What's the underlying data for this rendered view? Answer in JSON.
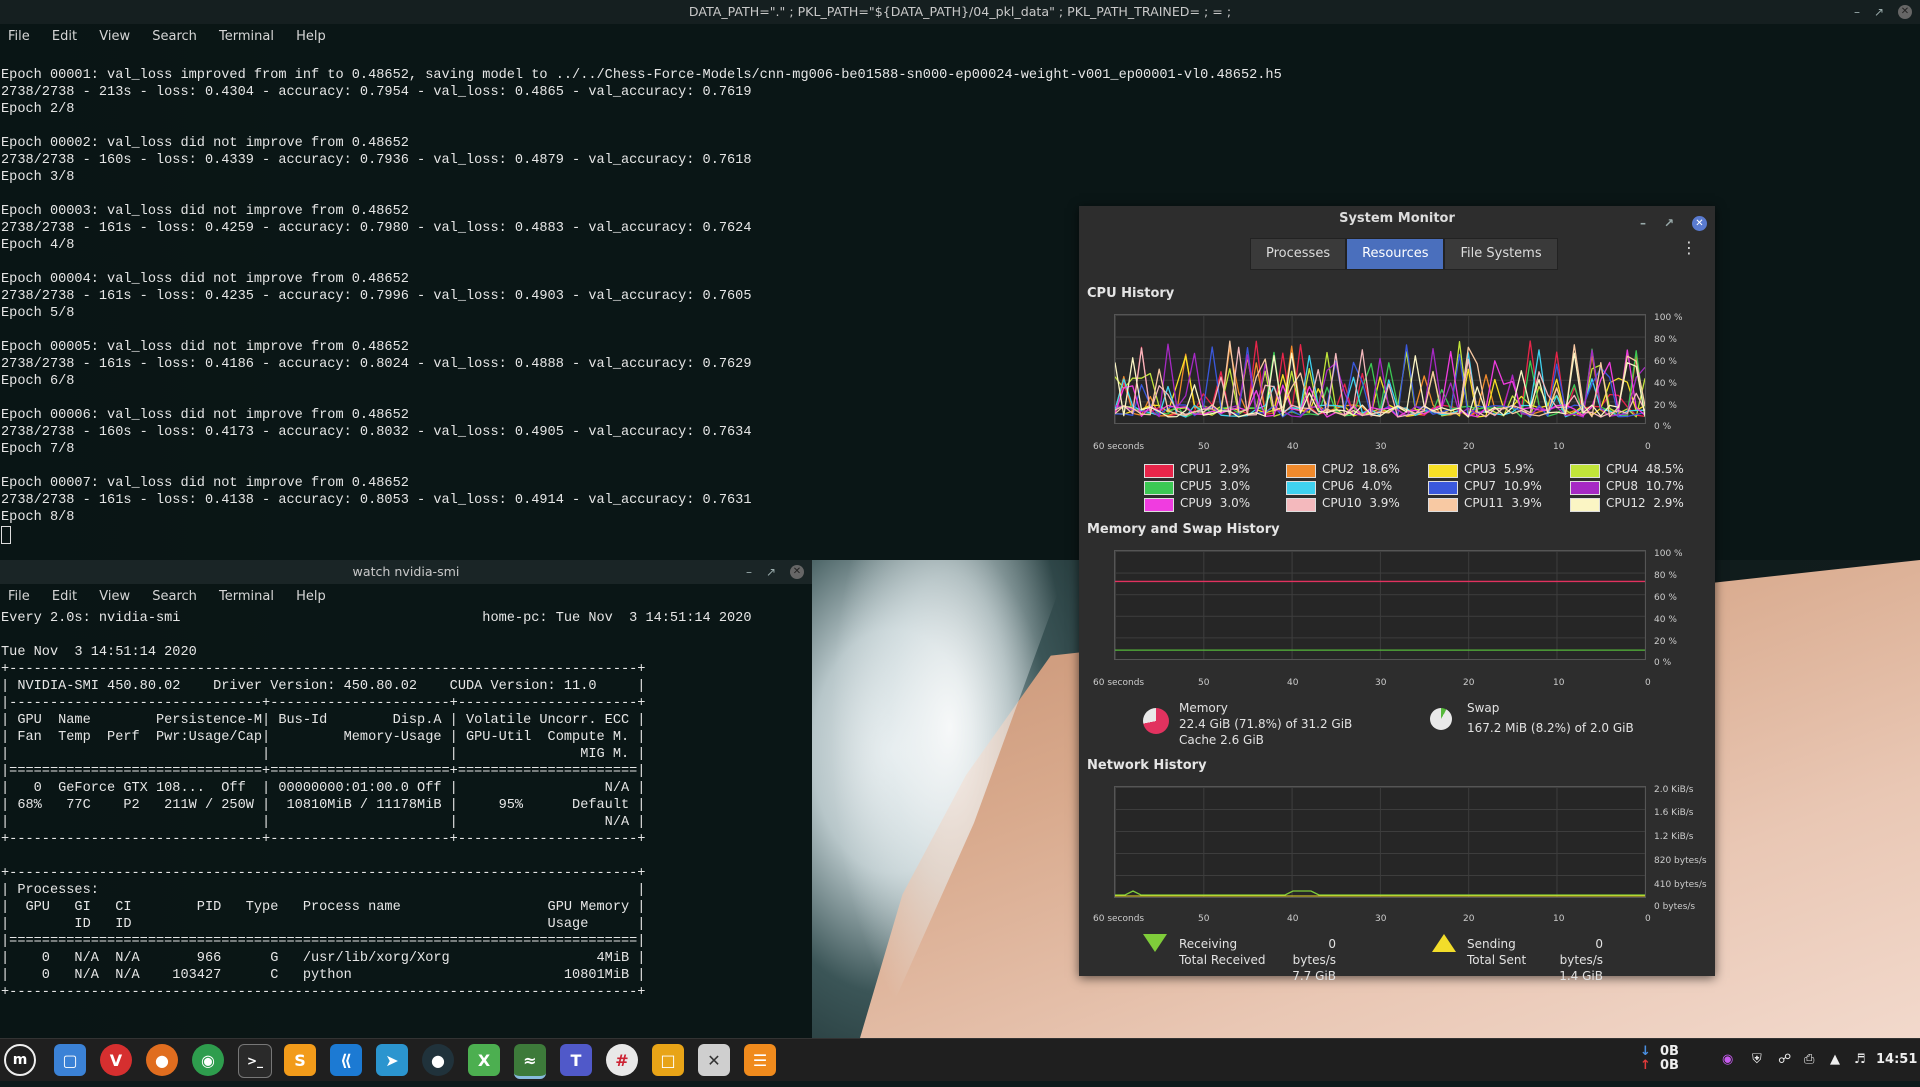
{
  "terminal_top": {
    "title": "DATA_PATH=\".\" ; PKL_PATH=\"${DATA_PATH}/04_pkl_data\" ; PKL_PATH_TRAINED= ; = ;",
    "menu": [
      "File",
      "Edit",
      "View",
      "Search",
      "Terminal",
      "Help"
    ],
    "output": "\nEpoch 00001: val_loss improved from inf to 0.48652, saving model to ../../Chess-Force-Models/cnn-mg006-be01588-sn000-ep00024-weight-v001_ep00001-vl0.48652.h5\n2738/2738 - 213s - loss: 0.4304 - accuracy: 0.7954 - val_loss: 0.4865 - val_accuracy: 0.7619\nEpoch 2/8\n\nEpoch 00002: val_loss did not improve from 0.48652\n2738/2738 - 160s - loss: 0.4339 - accuracy: 0.7936 - val_loss: 0.4879 - val_accuracy: 0.7618\nEpoch 3/8\n\nEpoch 00003: val_loss did not improve from 0.48652\n2738/2738 - 161s - loss: 0.4259 - accuracy: 0.7980 - val_loss: 0.4883 - val_accuracy: 0.7624\nEpoch 4/8\n\nEpoch 00004: val_loss did not improve from 0.48652\n2738/2738 - 161s - loss: 0.4235 - accuracy: 0.7996 - val_loss: 0.4903 - val_accuracy: 0.7605\nEpoch 5/8\n\nEpoch 00005: val_loss did not improve from 0.48652\n2738/2738 - 161s - loss: 0.4186 - accuracy: 0.8024 - val_loss: 0.4888 - val_accuracy: 0.7629\nEpoch 6/8\n\nEpoch 00006: val_loss did not improve from 0.48652\n2738/2738 - 160s - loss: 0.4173 - accuracy: 0.8032 - val_loss: 0.4905 - val_accuracy: 0.7634\nEpoch 7/8\n\nEpoch 00007: val_loss did not improve from 0.48652\n2738/2738 - 161s - loss: 0.4138 - accuracy: 0.8053 - val_loss: 0.4914 - val_accuracy: 0.7631\nEpoch 8/8"
  },
  "terminal_bottom": {
    "title": "watch nvidia-smi",
    "menu": [
      "File",
      "Edit",
      "View",
      "Search",
      "Terminal",
      "Help"
    ],
    "output": "Every 2.0s: nvidia-smi                                     home-pc: Tue Nov  3 14:51:14 2020\n\nTue Nov  3 14:51:14 2020\n+-----------------------------------------------------------------------------+\n| NVIDIA-SMI 450.80.02    Driver Version: 450.80.02    CUDA Version: 11.0     |\n|-------------------------------+----------------------+----------------------+\n| GPU  Name        Persistence-M| Bus-Id        Disp.A | Volatile Uncorr. ECC |\n| Fan  Temp  Perf  Pwr:Usage/Cap|         Memory-Usage | GPU-Util  Compute M. |\n|                               |                      |               MIG M. |\n|===============================+======================+======================|\n|   0  GeForce GTX 108...  Off  | 00000000:01:00.0 Off |                  N/A |\n| 68%   77C    P2   211W / 250W |  10810MiB / 11178MiB |     95%      Default |\n|                               |                      |                  N/A |\n+-------------------------------+----------------------+----------------------+\n\n+-----------------------------------------------------------------------------+\n| Processes:                                                                  |\n|  GPU   GI   CI        PID   Type   Process name                  GPU Memory |\n|        ID   ID                                                   Usage      |\n|=============================================================================|\n|    0   N/A  N/A       966      G   /usr/lib/xorg/Xorg                  4MiB |\n|    0   N/A  N/A    103427      C   python                          10801MiB |\n+-----------------------------------------------------------------------------+"
  },
  "system_monitor": {
    "title": "System Monitor",
    "tabs": [
      "Processes",
      "Resources",
      "File Systems"
    ],
    "active_tab": "Resources",
    "cpu_section": "CPU History",
    "mem_section": "Memory and Swap History",
    "net_section": "Network History",
    "y_percent": [
      "100 %",
      "80 %",
      "60 %",
      "40 %",
      "20 %",
      "0 %"
    ],
    "y_net": [
      "2.0 KiB/s",
      "1.6 KiB/s",
      "1.2 KiB/s",
      "820 bytes/s",
      "410 bytes/s",
      "0 bytes/s"
    ],
    "x_labels": [
      "60 seconds",
      "50",
      "40",
      "30",
      "20",
      "10",
      "0"
    ],
    "cpus": [
      {
        "label": "CPU1",
        "value": "2.9%",
        "color": "#e8254a"
      },
      {
        "label": "CPU2",
        "value": "18.6%",
        "color": "#f08a2c"
      },
      {
        "label": "CPU3",
        "value": "5.9%",
        "color": "#f7e026"
      },
      {
        "label": "CPU4",
        "value": "48.5%",
        "color": "#c1e43a"
      },
      {
        "label": "CPU5",
        "value": "3.0%",
        "color": "#3cc854"
      },
      {
        "label": "CPU6",
        "value": "4.0%",
        "color": "#3fd2f0"
      },
      {
        "label": "CPU7",
        "value": "10.9%",
        "color": "#3a58dc"
      },
      {
        "label": "CPU8",
        "value": "10.7%",
        "color": "#a629c4"
      },
      {
        "label": "CPU9",
        "value": "3.0%",
        "color": "#f03ce0"
      },
      {
        "label": "CPU10",
        "value": "3.9%",
        "color": "#f4b9bd"
      },
      {
        "label": "CPU11",
        "value": "3.9%",
        "color": "#f8c9a3"
      },
      {
        "label": "CPU12",
        "value": "2.9%",
        "color": "#fbf5c4"
      }
    ],
    "memory": {
      "label": "Memory",
      "line1": "22.4 GiB (71.8%) of 31.2 GiB",
      "line2": "Cache 2.6 GiB",
      "percent": 71.8,
      "color": "#e2325f"
    },
    "swap": {
      "label": "Swap",
      "line1": "167.2 MiB (8.2%) of 2.0 GiB",
      "percent": 8.2,
      "color": "#55b83a"
    },
    "network": {
      "receiving_label": "Receiving",
      "receiving_value": "0 bytes/s",
      "total_received_label": "Total Received",
      "total_received_value": "7.7 GiB",
      "sending_label": "Sending",
      "sending_value": "0 bytes/s",
      "total_sent_label": "Total Sent",
      "total_sent_value": "1.4 GiB"
    }
  },
  "taskbar": {
    "tray_net_down": "0B",
    "tray_net_up": "0B",
    "clock": "14:51"
  }
}
